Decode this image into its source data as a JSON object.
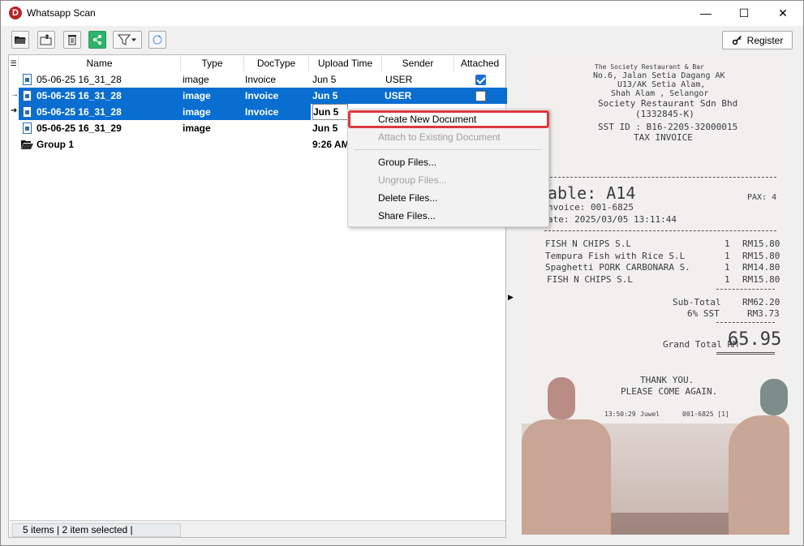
{
  "window": {
    "title": "Whatsapp Scan",
    "icon_letter": "D",
    "minimize": "—",
    "maximize": "☐",
    "close": "✕"
  },
  "toolbar": {
    "register_label": "Register"
  },
  "columns": [
    "Name",
    "Type",
    "DocType",
    "Upload Time",
    "Sender",
    "Attached"
  ],
  "rows": [
    {
      "name": "05-06-25 16_31_28",
      "type": "image",
      "doctype": "Invoice",
      "upload_time": "Jun 5",
      "sender": "USER",
      "attached": true
    },
    {
      "name": "05-06-25 16_31_28",
      "type": "image",
      "doctype": "Invoice",
      "upload_time": "Jun 5",
      "sender": "USER",
      "attached": false
    },
    {
      "name": "05-06-25 16_31_28",
      "type": "image",
      "doctype": "Invoice",
      "upload_time": "Jun 5",
      "sender": "",
      "attached": false
    },
    {
      "name": "05-06-25 16_31_29",
      "type": "image",
      "doctype": "",
      "upload_time": "Jun 5",
      "sender": "",
      "attached": false
    },
    {
      "name": "Group 1",
      "type": "",
      "doctype": "",
      "upload_time": "9:26 AM",
      "sender": "",
      "attached": false
    }
  ],
  "status": {
    "text": "5 items |  2 item selected |"
  },
  "context_menu": {
    "items": [
      {
        "label": "Create New Document",
        "enabled": true
      },
      {
        "label": "Attach to Existing Document",
        "enabled": false
      },
      {
        "label": "Group Files...",
        "enabled": true
      },
      {
        "label": "Ungroup Files...",
        "enabled": false
      },
      {
        "label": "Delete Files...",
        "enabled": true
      },
      {
        "label": "Share Files...",
        "enabled": true
      }
    ]
  },
  "receipt": {
    "header": [
      "The Society Restaurant & Bar",
      "No.6, Jalan Setia Dagang AK",
      "U13/AK Setia Alam,",
      "Shah Alam , Selangor",
      "Society Restaurant Sdn Bhd",
      "(1332845-K)",
      "SST ID : B16-2205-32000015",
      "TAX INVOICE"
    ],
    "table": "able: A14",
    "pax": "PAX: 4",
    "invoice": "nvoice: 001-6825",
    "date": "ate: 2025/03/05 13:11:44",
    "items": [
      {
        "name": "FISH N CHIPS S.L",
        "qty": "1",
        "price": "RM15.80"
      },
      {
        "name": "Tempura Fish with Rice S.L",
        "qty": "1",
        "price": "RM15.80"
      },
      {
        "name": "Spaghetti PORK CARBONARA S.",
        "qty": "1",
        "price": "RM14.80"
      },
      {
        "name": "FISH N CHIPS S.L",
        "qty": "1",
        "price": "RM15.80"
      }
    ],
    "subtotal_label": "Sub-Total",
    "subtotal": "RM62.20",
    "sst_label": "6% SST",
    "sst": "RM3.73",
    "grand_label": "Grand Total RM",
    "grand": "65.95",
    "thanks": "THANK YOU.",
    "again": "PLEASE COME AGAIN.",
    "footer_time": "13:50:29",
    "footer_user": "Juwel",
    "footer_inv": "001-6825 [1]"
  }
}
